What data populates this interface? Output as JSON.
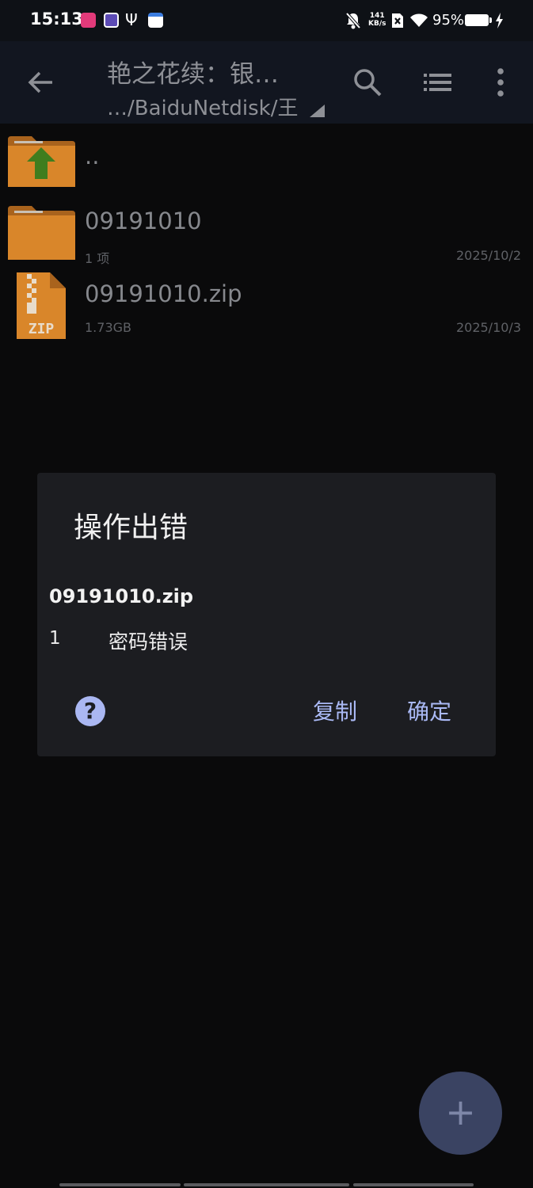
{
  "status_bar": {
    "time": "15:13",
    "speed_value": "141",
    "speed_unit": "KB/s",
    "battery_percent": "95%",
    "icons": [
      "app-icon-pink",
      "app-icon-purple",
      "usb-icon",
      "app-icon-calendar",
      "mute-bell-icon",
      "sim-x-icon",
      "wifi-icon",
      "battery-icon",
      "charging-bolt-icon"
    ]
  },
  "toolbar": {
    "title": "艳之花续：银…",
    "path": "…/BaiduNetdisk/王"
  },
  "files": [
    {
      "name": "..",
      "meta": "",
      "date": "",
      "icon": "folder-up-icon"
    },
    {
      "name": "09191010",
      "meta": "1 项",
      "date": "2025/10/2",
      "icon": "folder-icon"
    },
    {
      "name": "09191010.zip",
      "meta": "1.73GB",
      "date": "2025/10/3",
      "icon": "zip-file-icon"
    }
  ],
  "dialog": {
    "title": "操作出错",
    "file_name": "09191010.zip",
    "error_index": "1",
    "error_message": "密码错误",
    "help_label": "?",
    "copy_label": "复制",
    "ok_label": "确定"
  },
  "fab": {
    "label": "+"
  },
  "colors": {
    "accent": "#aab9f5",
    "folder": "#d9862a",
    "arrow_green": "#3f7d1e",
    "dialog_bg": "#1c1d21"
  }
}
